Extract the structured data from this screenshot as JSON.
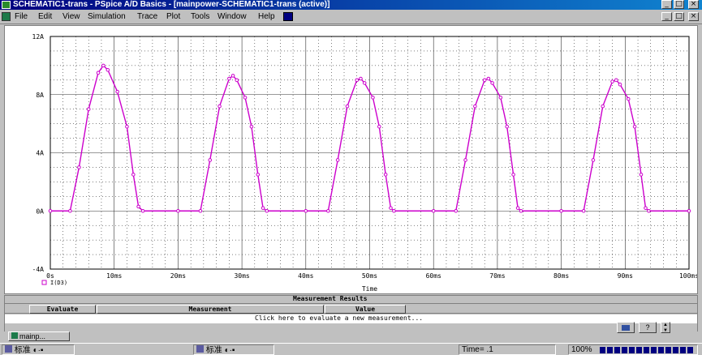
{
  "window": {
    "title": "SCHEMATIC1-trans - PSpice A/D Basics - [mainpower-SCHEMATIC1-trans (active)]",
    "buttons": [
      "_",
      "□",
      "×"
    ]
  },
  "menu": {
    "items": [
      "File",
      "Edit",
      "View",
      "Simulation",
      "Trace",
      "Plot",
      "Tools",
      "Window",
      "Help"
    ],
    "doc_buttons": [
      "_",
      "□",
      "×"
    ]
  },
  "colors": {
    "trace": "#cc00cc",
    "grid": "#000000",
    "titlebar": "#000080"
  },
  "chart_data": {
    "type": "line",
    "title": "",
    "xlabel": "Time",
    "ylabel": "",
    "xlim": [
      0,
      100
    ],
    "ylim": [
      -4,
      12
    ],
    "x_unit": "ms",
    "xticks": [
      0,
      10,
      20,
      30,
      40,
      50,
      60,
      70,
      80,
      90,
      100
    ],
    "xtick_labels": [
      "0s",
      "10ms",
      "20ms",
      "30ms",
      "40ms",
      "50ms",
      "60ms",
      "70ms",
      "80ms",
      "90ms",
      "100ms"
    ],
    "yticks": [
      -4,
      0,
      4,
      8,
      12
    ],
    "ytick_labels": [
      "-4A",
      "0A",
      "4A",
      "8A",
      "12A"
    ],
    "grid": true,
    "legend": "bottom-left",
    "series": [
      {
        "name": "I(D3)",
        "x": [
          0,
          3.1,
          4.5,
          6,
          7.5,
          8.3,
          9,
          10.5,
          12,
          13,
          13.8,
          14.5,
          20,
          23.5,
          25,
          26.5,
          28,
          28.6,
          29.2,
          30.5,
          31.5,
          32.5,
          33.3,
          33.9,
          40,
          43.5,
          45,
          46.5,
          48,
          48.6,
          49.2,
          50.5,
          51.5,
          52.5,
          53.3,
          53.8,
          60,
          63.5,
          65,
          66.5,
          68,
          68.6,
          69.2,
          70.5,
          71.5,
          72.5,
          73.2,
          73.7,
          80,
          83.5,
          85,
          86.5,
          88,
          88.6,
          89.2,
          90.5,
          91.5,
          92.5,
          93.2,
          93.7,
          100
        ],
        "y": [
          0,
          0,
          3,
          7,
          9.5,
          10,
          9.7,
          8.2,
          5.8,
          2.5,
          0.3,
          0,
          0,
          0,
          3.5,
          7.2,
          9.1,
          9.3,
          9,
          7.8,
          5.8,
          2.5,
          0.2,
          0,
          0,
          0,
          3.5,
          7.2,
          9,
          9.1,
          8.8,
          7.8,
          5.8,
          2.5,
          0.2,
          0,
          0,
          0,
          3.5,
          7.2,
          9,
          9.1,
          8.8,
          7.8,
          5.8,
          2.5,
          0.2,
          0,
          0,
          0,
          3.5,
          7.2,
          8.9,
          9,
          8.7,
          7.7,
          5.8,
          2.5,
          0.2,
          0,
          0
        ]
      }
    ]
  },
  "measurement": {
    "title": "Measurement Results",
    "columns": [
      "Evaluate",
      "Measurement",
      "Value"
    ],
    "prompt": "Click here to evaluate a new measurement..."
  },
  "tabs": {
    "active": "mainp..."
  },
  "status": {
    "time": "Time= .1",
    "zoom": "100%"
  },
  "taskbar": {
    "ime1": "标准",
    "ime2": "标准"
  }
}
